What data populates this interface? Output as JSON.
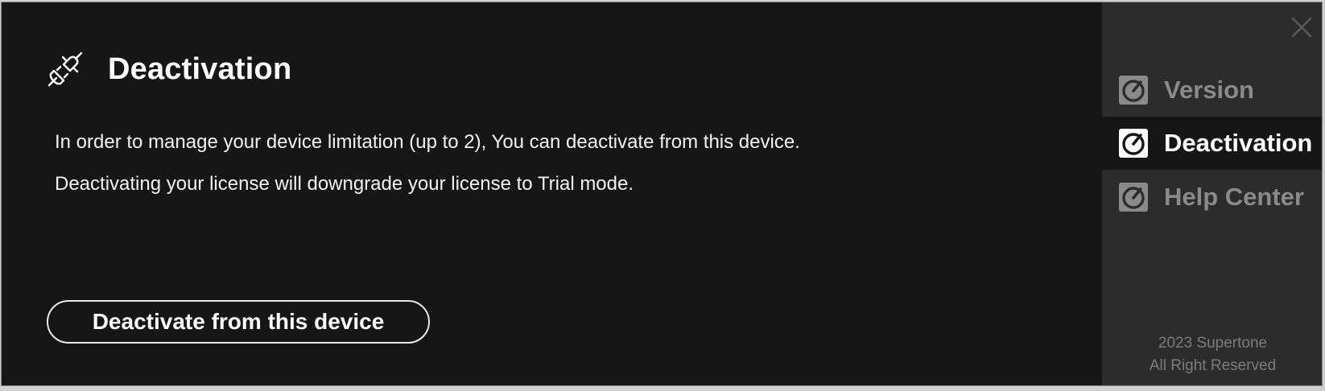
{
  "main": {
    "title": "Deactivation",
    "icon": "plug-icon",
    "description_line1": "In order to manage your device limitation (up to 2), You can deactivate from this device.",
    "description_line2": "Deactivating your license will downgrade your license to Trial mode.",
    "deactivate_button_label": "Deactivate from this device"
  },
  "sidebar": {
    "close_icon": "close-icon",
    "items": [
      {
        "label": "Version",
        "icon": "dial-icon",
        "active": false
      },
      {
        "label": "Deactivation",
        "icon": "dial-icon",
        "active": true
      },
      {
        "label": "Help Center",
        "icon": "dial-icon",
        "active": false
      }
    ],
    "footer_line1": "2023 Supertone",
    "footer_line2": "All Right Reserved"
  },
  "colors": {
    "main_bg": "#161616",
    "sidebar_bg": "#2c2c2c",
    "active_item_bg": "#161616",
    "text_primary": "#ffffff",
    "text_muted": "#8a8a8a"
  }
}
